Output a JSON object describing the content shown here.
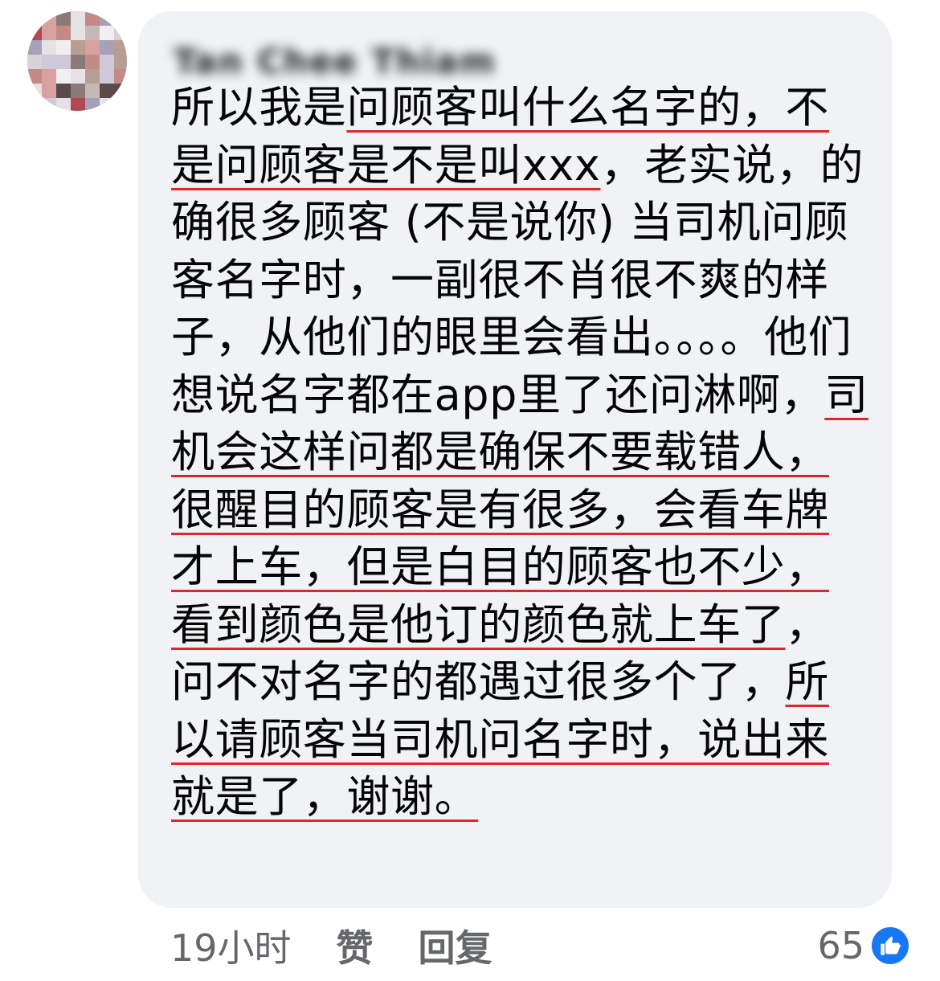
{
  "comment": {
    "author": "Tan Chee Thiam",
    "segments": [
      {
        "text": "所以我是",
        "hl": false
      },
      {
        "text": "问顾客叫什么名字的，不是问顾客是不是叫xxx",
        "hl": true
      },
      {
        "text": "，老实说，的确很多顾客 (不是说你) 当司机问顾客名字时，一副很不肖很不爽的样子，从他们的眼里会看出。。。。他们想说名字都在app里了还问淋啊，",
        "hl": false
      },
      {
        "text": "司机会这样问都是确保不要载错人，很醒目的顾客是有很多，会看车牌才上车，但是白目的顾客也不少，看到颜色是他订的颜色就上车了",
        "hl": true
      },
      {
        "text": "，问不对名字的都遇过很多个了，",
        "hl": false
      },
      {
        "text": "所以请顾客当司机问名字时，说出来就是了，谢谢。",
        "hl": true
      }
    ],
    "time": "19小时",
    "like_label": "赞",
    "reply_label": "回复",
    "reaction_count": "65",
    "reaction_icon": "thumbs-up-icon",
    "colors": {
      "bubble": "#f0f2f5",
      "underline": "#e0262a",
      "meta": "#65676b",
      "like_blue": "#1877f2"
    }
  }
}
